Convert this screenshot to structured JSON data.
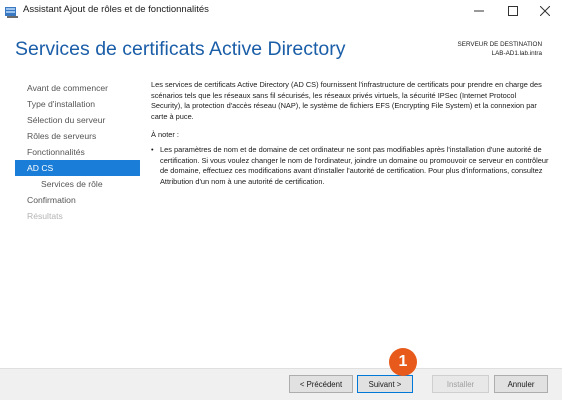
{
  "window": {
    "title": "Assistant Ajout de rôles et de fonctionnalités",
    "minimize_icon": "minimize-icon",
    "maximize_icon": "maximize-icon",
    "close_icon": "close-icon"
  },
  "header": {
    "title": "Services de certificats Active Directory",
    "destination_label": "SERVEUR DE DESTINATION",
    "destination_value": "LAB-AD1.lab.intra"
  },
  "nav": {
    "items": [
      {
        "label": "Avant de commencer",
        "state": "normal"
      },
      {
        "label": "Type d'installation",
        "state": "normal"
      },
      {
        "label": "Sélection du serveur",
        "state": "normal"
      },
      {
        "label": "Rôles de serveurs",
        "state": "normal"
      },
      {
        "label": "Fonctionnalités",
        "state": "normal"
      },
      {
        "label": "AD CS",
        "state": "active"
      },
      {
        "label": "Services de rôle",
        "state": "sub"
      },
      {
        "label": "Confirmation",
        "state": "normal"
      },
      {
        "label": "Résultats",
        "state": "disabled"
      }
    ]
  },
  "content": {
    "intro": "Les services de certificats Active Directory (AD CS) fournissent l'infrastructure de certificats pour prendre en charge des scénarios tels que les réseaux sans fil sécurisés, les réseaux privés virtuels, la sécurité IPSec (Internet Protocol Security), la protection d'accès réseau (NAP), le système de fichiers EFS (Encrypting File System) et la connexion par carte à puce.",
    "note_label": "À noter :",
    "note_bullet": "•",
    "note_text": "Les paramètres de nom et de domaine de cet ordinateur ne sont pas modifiables après l'installation d'une autorité de certification. Si vous voulez changer le nom de l'ordinateur, joindre un domaine ou promouvoir ce serveur en contrôleur de domaine, effectuez ces modifications avant d'installer l'autorité de certification. Pour plus d'informations, consultez Attribution d'un nom à une autorité de certification."
  },
  "footer": {
    "prev_label": "< Précédent",
    "next_label": "Suivant >",
    "install_label": "Installer",
    "cancel_label": "Annuler"
  },
  "annotation": {
    "marker_number": "1",
    "marker_color": "#e85a1b"
  },
  "colors": {
    "accent": "#1a7dd7",
    "title_blue": "#1b5ea8"
  }
}
